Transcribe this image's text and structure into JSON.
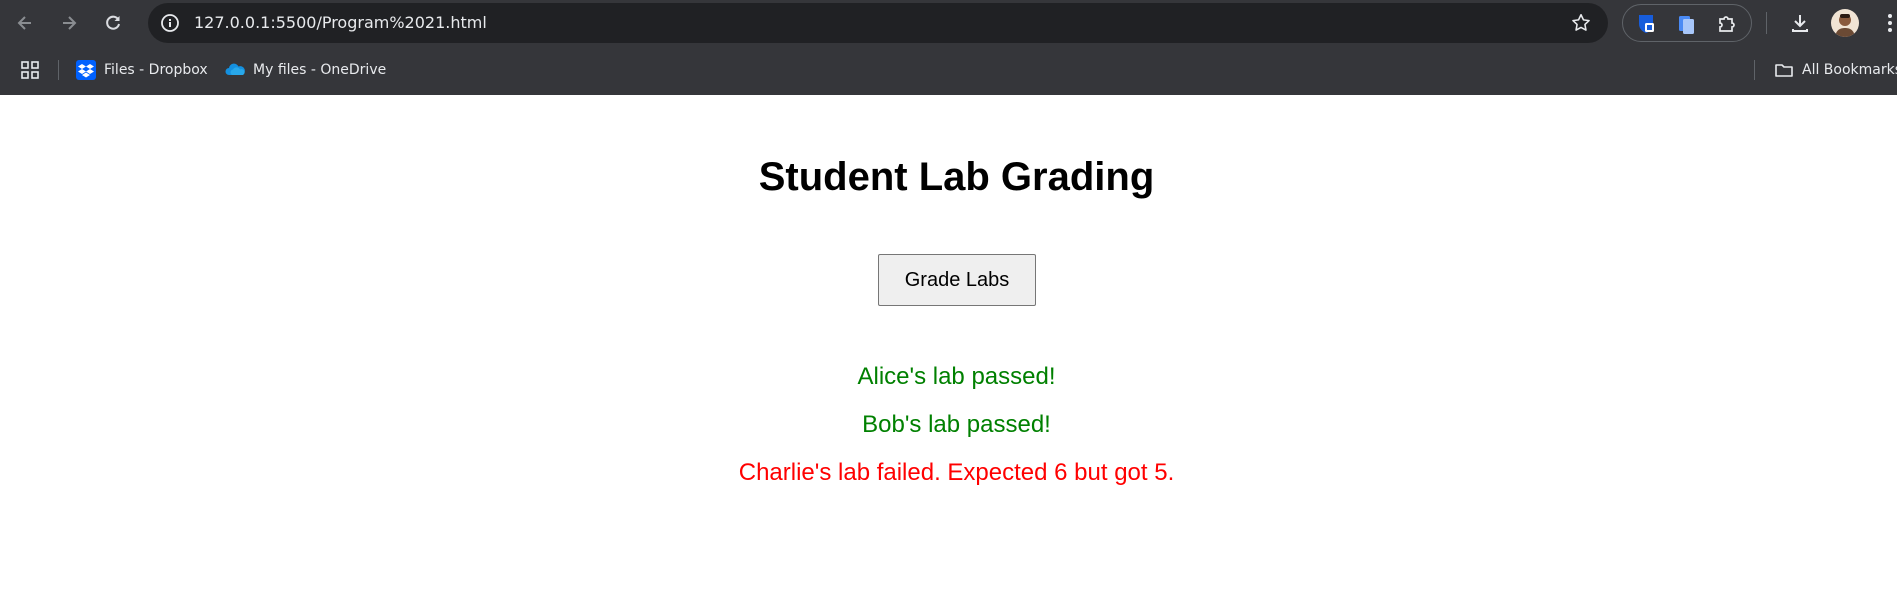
{
  "browser": {
    "url": "127.0.0.1:5500/Program%2021.html",
    "bookmarks": [
      {
        "label": "Files - Dropbox",
        "icon": "dropbox-icon"
      },
      {
        "label": "My files - OneDrive",
        "icon": "onedrive-icon"
      }
    ],
    "all_bookmarks_label": "All Bookmarks"
  },
  "page": {
    "title": "Student Lab Grading",
    "grade_button_label": "Grade Labs",
    "results": [
      {
        "text": "Alice's lab passed!",
        "status": "pass",
        "color": "#008000"
      },
      {
        "text": "Bob's lab passed!",
        "status": "pass",
        "color": "#008000"
      },
      {
        "text": "Charlie's lab failed. Expected 6 but got 5.",
        "status": "fail",
        "color": "#ff0000"
      }
    ]
  },
  "colors": {
    "chrome_bg": "#35363a",
    "omnibox_bg": "#202124",
    "pass": "#008000",
    "fail": "#ff0000"
  }
}
